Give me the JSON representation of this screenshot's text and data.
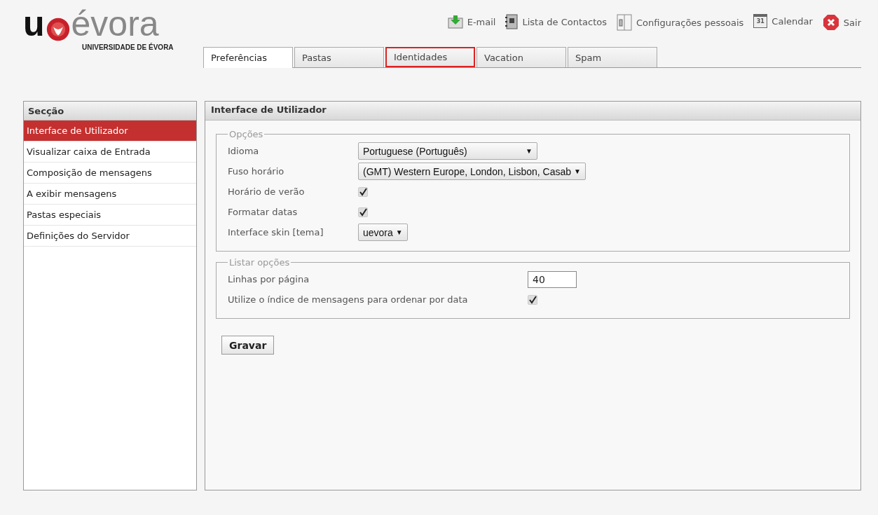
{
  "logo": {
    "left": "u",
    "right": "évora",
    "subtitle": "UNIVERSIDADE DE ÉVORA"
  },
  "top_nav": [
    {
      "label": "E-mail"
    },
    {
      "label": "Lista de Contactos"
    },
    {
      "label": "Configurações pessoais"
    },
    {
      "label": "Calendar",
      "icon_text": "31"
    },
    {
      "label": "Sair"
    }
  ],
  "tabs": [
    {
      "label": "Preferências",
      "selected": true,
      "focused": false
    },
    {
      "label": "Pastas",
      "selected": false,
      "focused": false
    },
    {
      "label": "Identidades",
      "selected": false,
      "focused": true
    },
    {
      "label": "Vacation",
      "selected": false,
      "focused": false
    },
    {
      "label": "Spam",
      "selected": false,
      "focused": false
    }
  ],
  "sidebar": {
    "title": "Secção",
    "items": [
      {
        "label": "Interface de Utilizador",
        "selected": true
      },
      {
        "label": "Visualizar caixa de Entrada",
        "selected": false
      },
      {
        "label": "Composição de mensagens",
        "selected": false
      },
      {
        "label": "A exibir mensagens",
        "selected": false
      },
      {
        "label": "Pastas especiais",
        "selected": false
      },
      {
        "label": "Definições do Servidor",
        "selected": false
      }
    ]
  },
  "panel": {
    "title": "Interface de Utilizador",
    "groups": [
      {
        "legend": "Opções",
        "rows": [
          {
            "kind": "select",
            "label": "Idioma",
            "value": "Portuguese (Português)",
            "arrow": "▼"
          },
          {
            "kind": "select",
            "label": "Fuso horário",
            "value": "(GMT) Western Europe, London, Lisbon, Casab",
            "arrow": "▼"
          },
          {
            "kind": "checkbox",
            "label": "Horário de verão",
            "checked": true
          },
          {
            "kind": "checkbox",
            "label": "Formatar datas",
            "checked": true
          },
          {
            "kind": "select",
            "label": "Interface skin [tema]",
            "value": "uevora",
            "arrow": "▼"
          }
        ]
      },
      {
        "legend": "Listar opções",
        "rows": [
          {
            "kind": "text",
            "label": "Linhas por página",
            "value": "40"
          },
          {
            "kind": "checkbox",
            "label": "Utilize o índice de mensagens para ordenar por data",
            "checked": true
          }
        ]
      }
    ],
    "save_button": "Gravar"
  }
}
